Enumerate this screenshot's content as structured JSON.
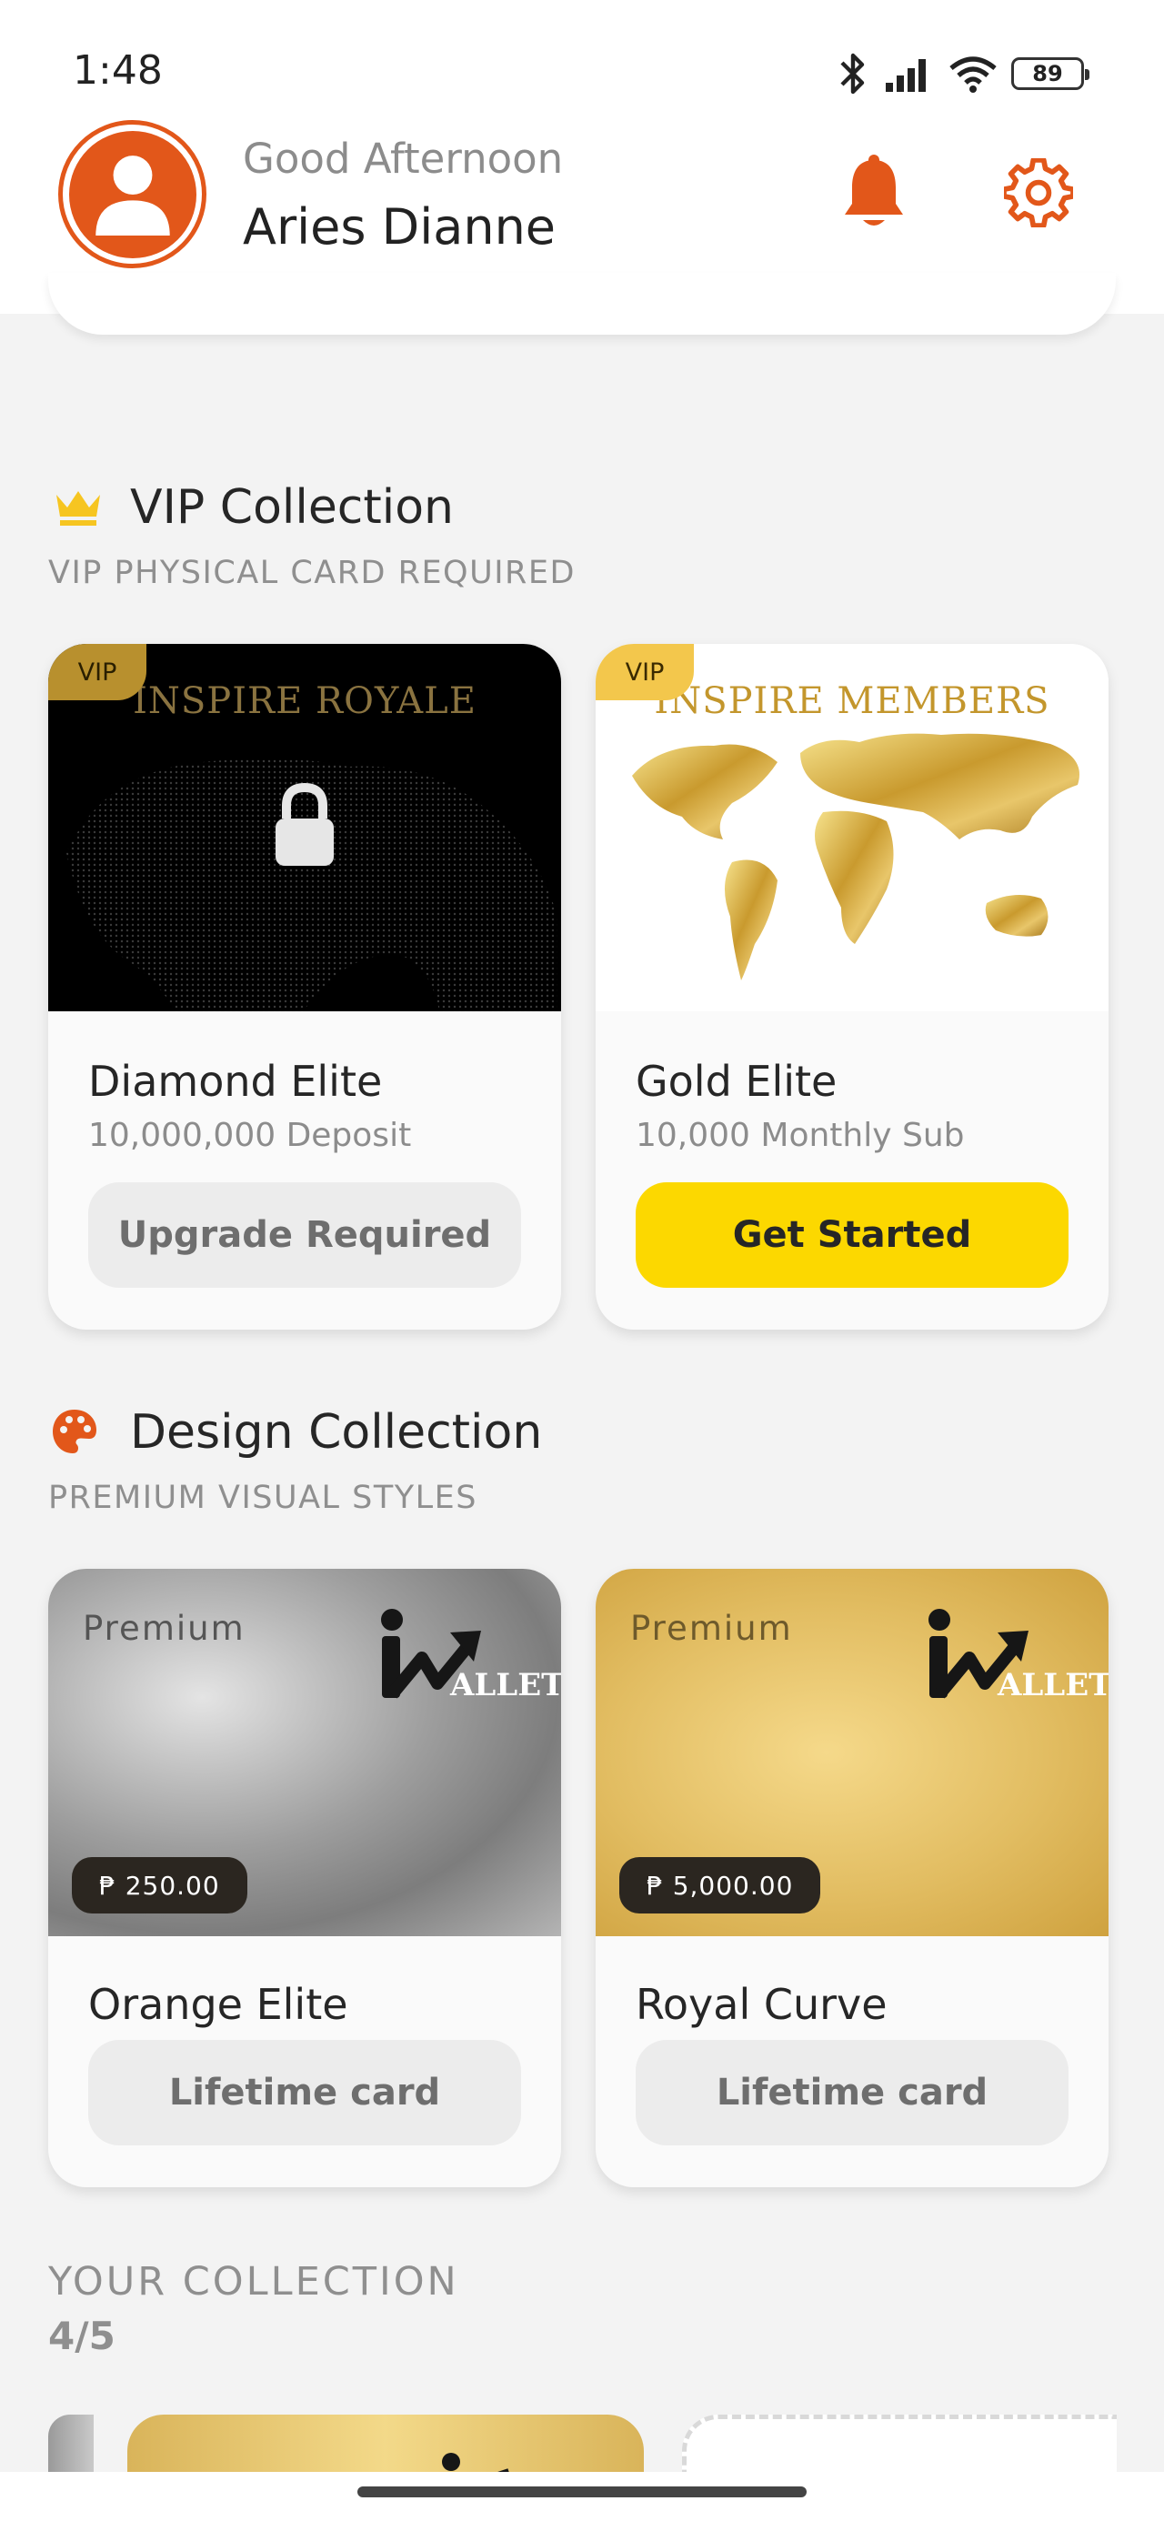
{
  "status": {
    "time": "1:48",
    "battery": "89"
  },
  "header": {
    "greeting": "Good Afternoon",
    "username": "Aries Dianne"
  },
  "vip": {
    "title": "VIP Collection",
    "subtitle": "VIP PHYSICAL CARD REQUIRED",
    "cards": [
      {
        "badge": "VIP",
        "brand": "INSPIRE ROYALE",
        "name": "Diamond Elite",
        "sub": "10,000,000 Deposit",
        "button": "Upgrade Required",
        "locked": true
      },
      {
        "badge": "VIP",
        "brand": "INSPIRE MEMBERS",
        "name": "Gold Elite",
        "sub": "10,000 Monthly Sub",
        "button": "Get Started",
        "locked": false
      }
    ]
  },
  "design": {
    "title": "Design Collection",
    "subtitle": "PREMIUM VISUAL STYLES",
    "cards": [
      {
        "label": "Premium",
        "logo_text": "ALLET",
        "price": "₱ 250.00",
        "name": "Orange Elite",
        "button": "Lifetime card"
      },
      {
        "label": "Premium",
        "logo_text": "ALLET",
        "price": "₱ 5,000.00",
        "name": "Royal Curve",
        "button": "Lifetime card"
      }
    ]
  },
  "collection": {
    "label": "YOUR COLLECTION",
    "count": "4/5"
  },
  "colors": {
    "accent": "#e2571a",
    "cta_yellow": "#fcd800",
    "gold": "#d4a94a"
  },
  "icons": [
    "bluetooth-icon",
    "signal-icon",
    "wifi-icon",
    "battery-icon",
    "user-icon",
    "bell-icon",
    "gear-icon",
    "crown-icon",
    "palette-icon",
    "lock-icon"
  ]
}
